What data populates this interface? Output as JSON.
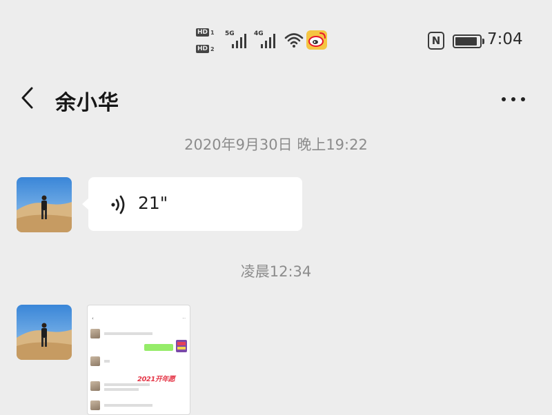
{
  "status_bar": {
    "hd_label": "HD",
    "sim1_index": "1",
    "sim2_index": "2",
    "network1": "5G",
    "network2": "4G",
    "battery_level": 0.9,
    "time": "7:04",
    "icons": [
      "hd-icon",
      "signal-icon",
      "wifi-icon",
      "weibo-icon",
      "nfc-icon",
      "battery-icon"
    ]
  },
  "header": {
    "back_icon": "chevron-left-icon",
    "title": "余小华",
    "more_icon": "more-dots-icon"
  },
  "messages": [
    {
      "type": "timestamp",
      "text": "2020年9月30日 晚上19:22"
    },
    {
      "type": "voice",
      "sender": "contact",
      "duration": "21\"",
      "icon": "voice-wave-icon"
    },
    {
      "type": "timestamp",
      "text": "凌晨12:34"
    },
    {
      "type": "image",
      "sender": "contact",
      "thumbnail_banner": "2021开年愿"
    }
  ],
  "colors": {
    "background": "#ededed",
    "bubble": "#ffffff",
    "timestamp_text": "#8c8c8c",
    "weibo_red": "#e6162d",
    "weibo_yellow": "#f5a623"
  }
}
